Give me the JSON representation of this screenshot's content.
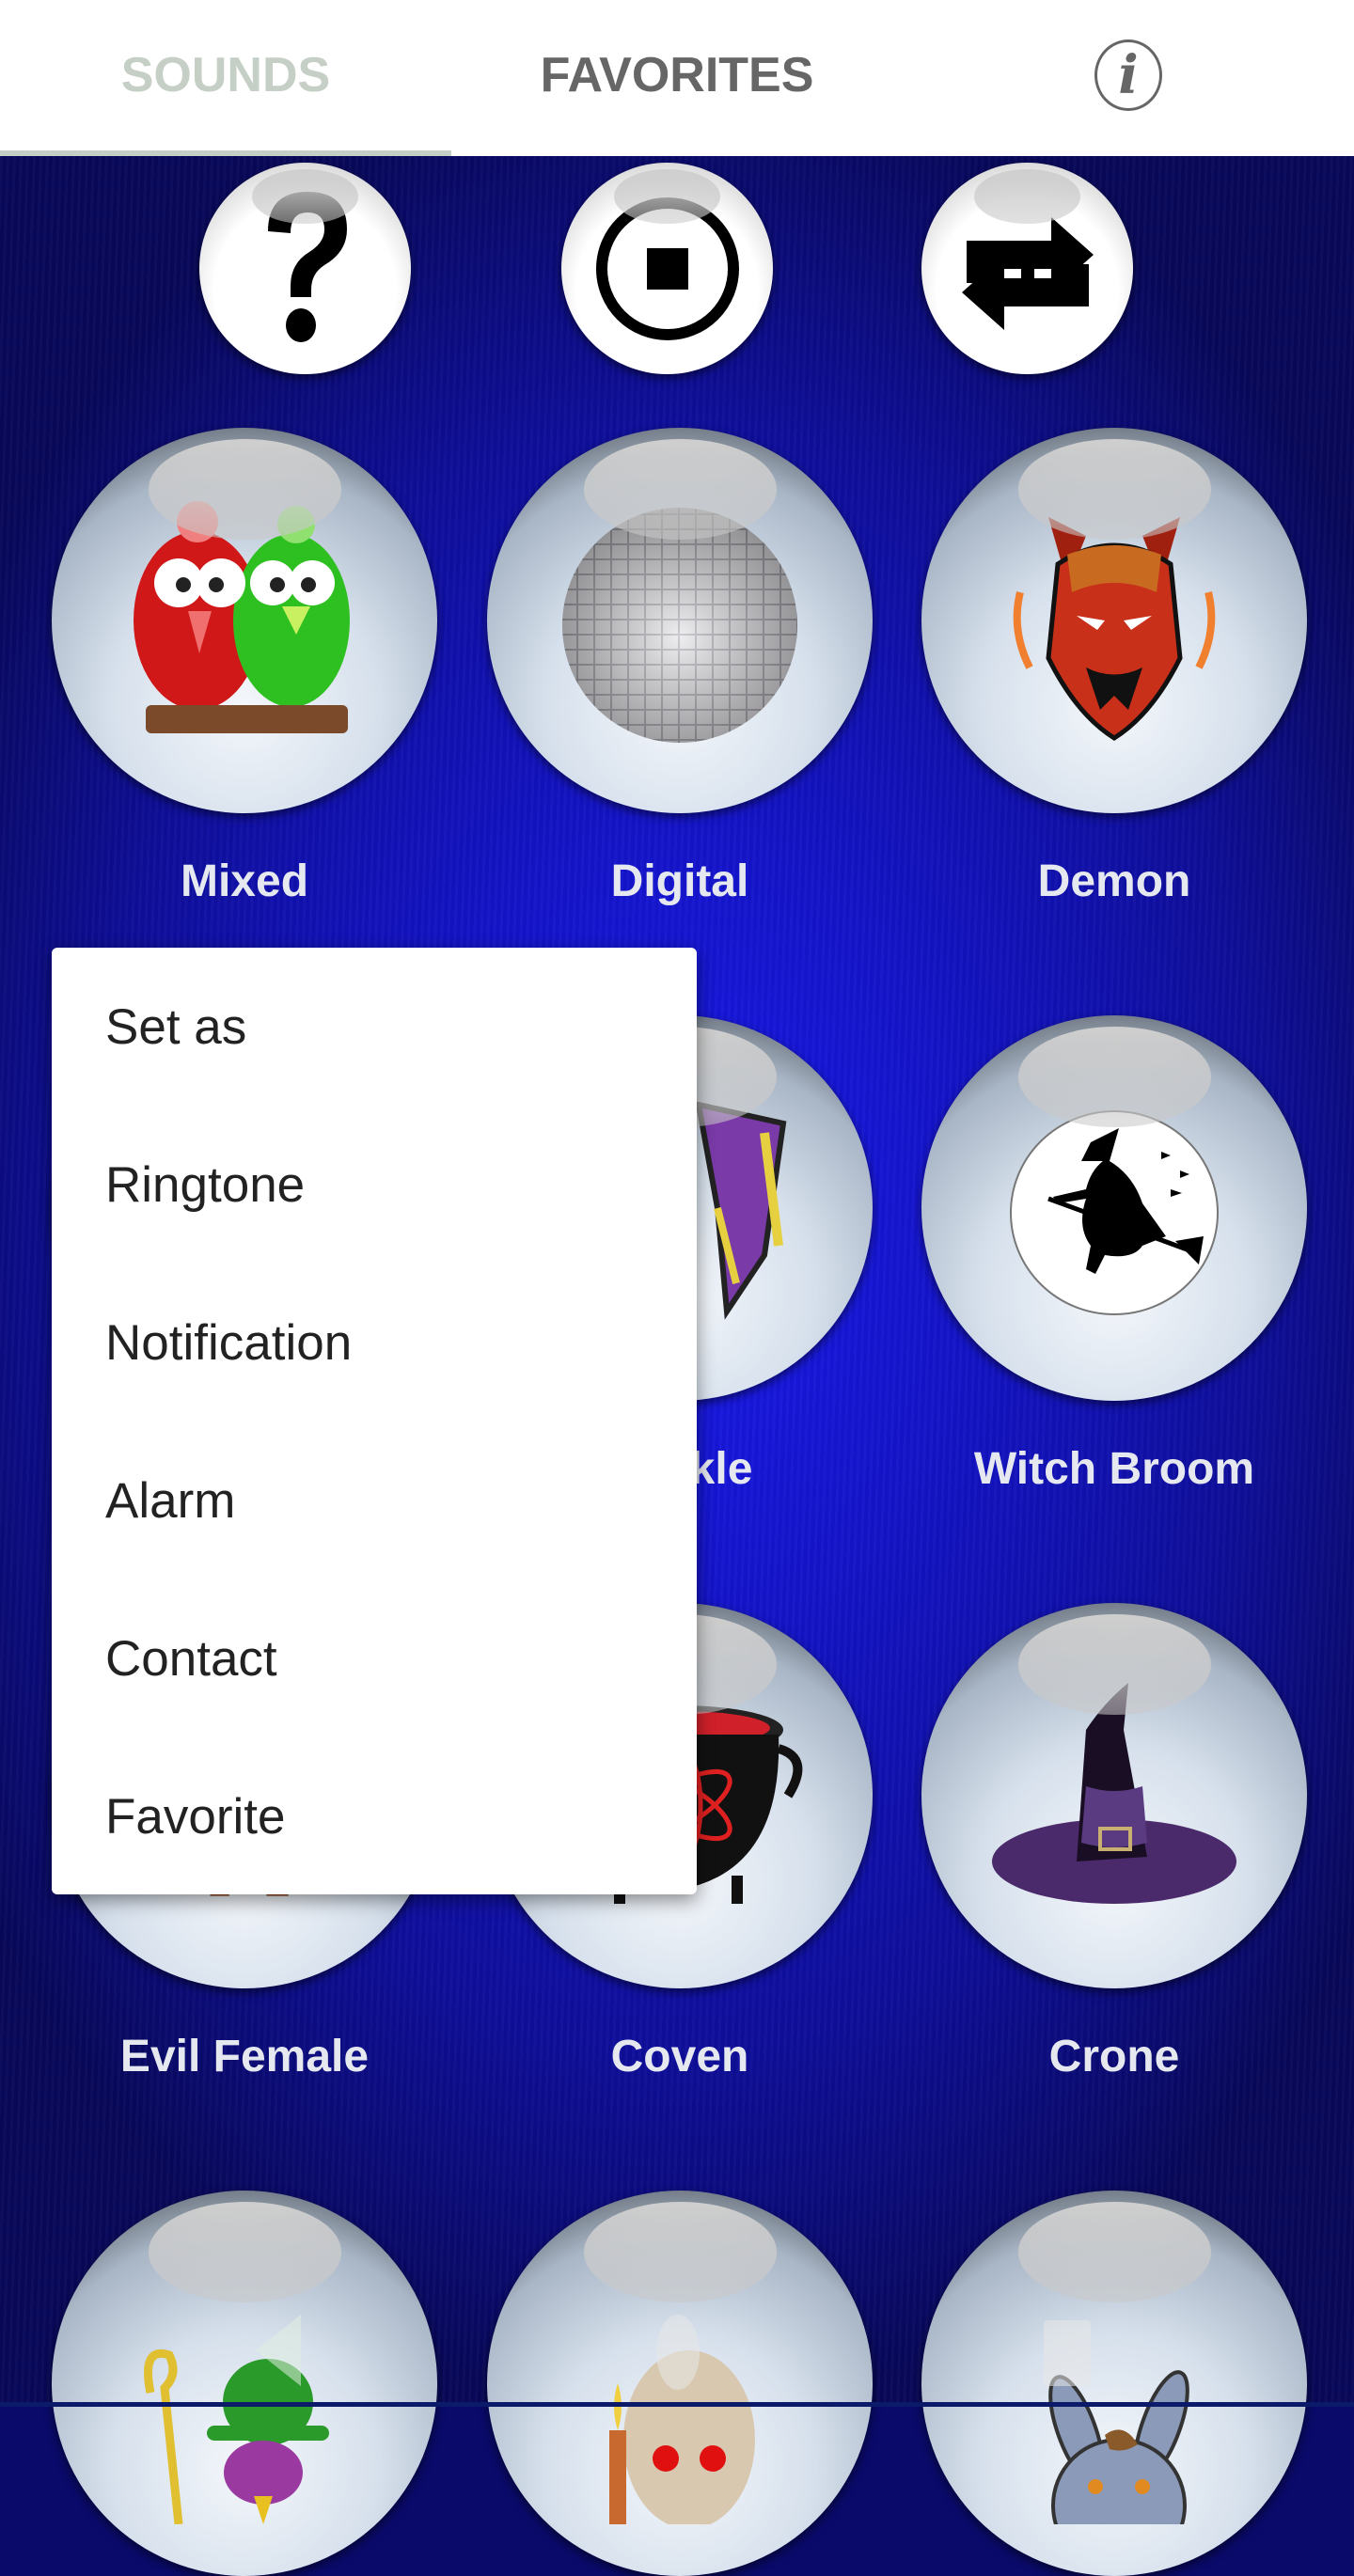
{
  "tabs": {
    "sounds_label": "SOUNDS",
    "favorites_label": "FAVORITES",
    "active": "SOUNDS",
    "info_icon": "info-icon"
  },
  "colors": {
    "tab_active": "#c5cfc5",
    "tab_inactive": "#666666",
    "background": "#1414c8",
    "label_text": "#e6e8f0"
  },
  "controls": [
    {
      "name": "help",
      "icon": "question-mark-icon",
      "glyph": "?"
    },
    {
      "name": "stop",
      "icon": "stop-icon"
    },
    {
      "name": "repeat",
      "icon": "repeat-icon"
    }
  ],
  "tiles": [
    {
      "label": "Mixed",
      "image": "two-birds-image"
    },
    {
      "label": "Digital",
      "image": "disco-ball-image"
    },
    {
      "label": "Demon",
      "image": "demon-face-image"
    },
    {
      "label": "",
      "image": "evil-female-image"
    },
    {
      "label": "Cackle",
      "visible_label": "kle",
      "image": "witch-hat-purple-image"
    },
    {
      "label": "Witch Broom",
      "image": "witch-on-broom-image"
    },
    {
      "label": "Evil Female",
      "image": "evil-female-image"
    },
    {
      "label": "Coven",
      "image": "cauldron-image"
    },
    {
      "label": "Crone",
      "image": "witch-hat-image"
    },
    {
      "label": "",
      "image": "green-hat-bird-image"
    },
    {
      "label": "",
      "image": "skull-candle-image"
    },
    {
      "label": "",
      "image": "donkey-image"
    }
  ],
  "context_menu": {
    "title": "Set as",
    "items": [
      "Ringtone",
      "Notification",
      "Alarm",
      "Contact",
      "Favorite"
    ]
  },
  "nav": {
    "back": "back-icon",
    "home": "home-icon",
    "recents": "recents-icon"
  }
}
